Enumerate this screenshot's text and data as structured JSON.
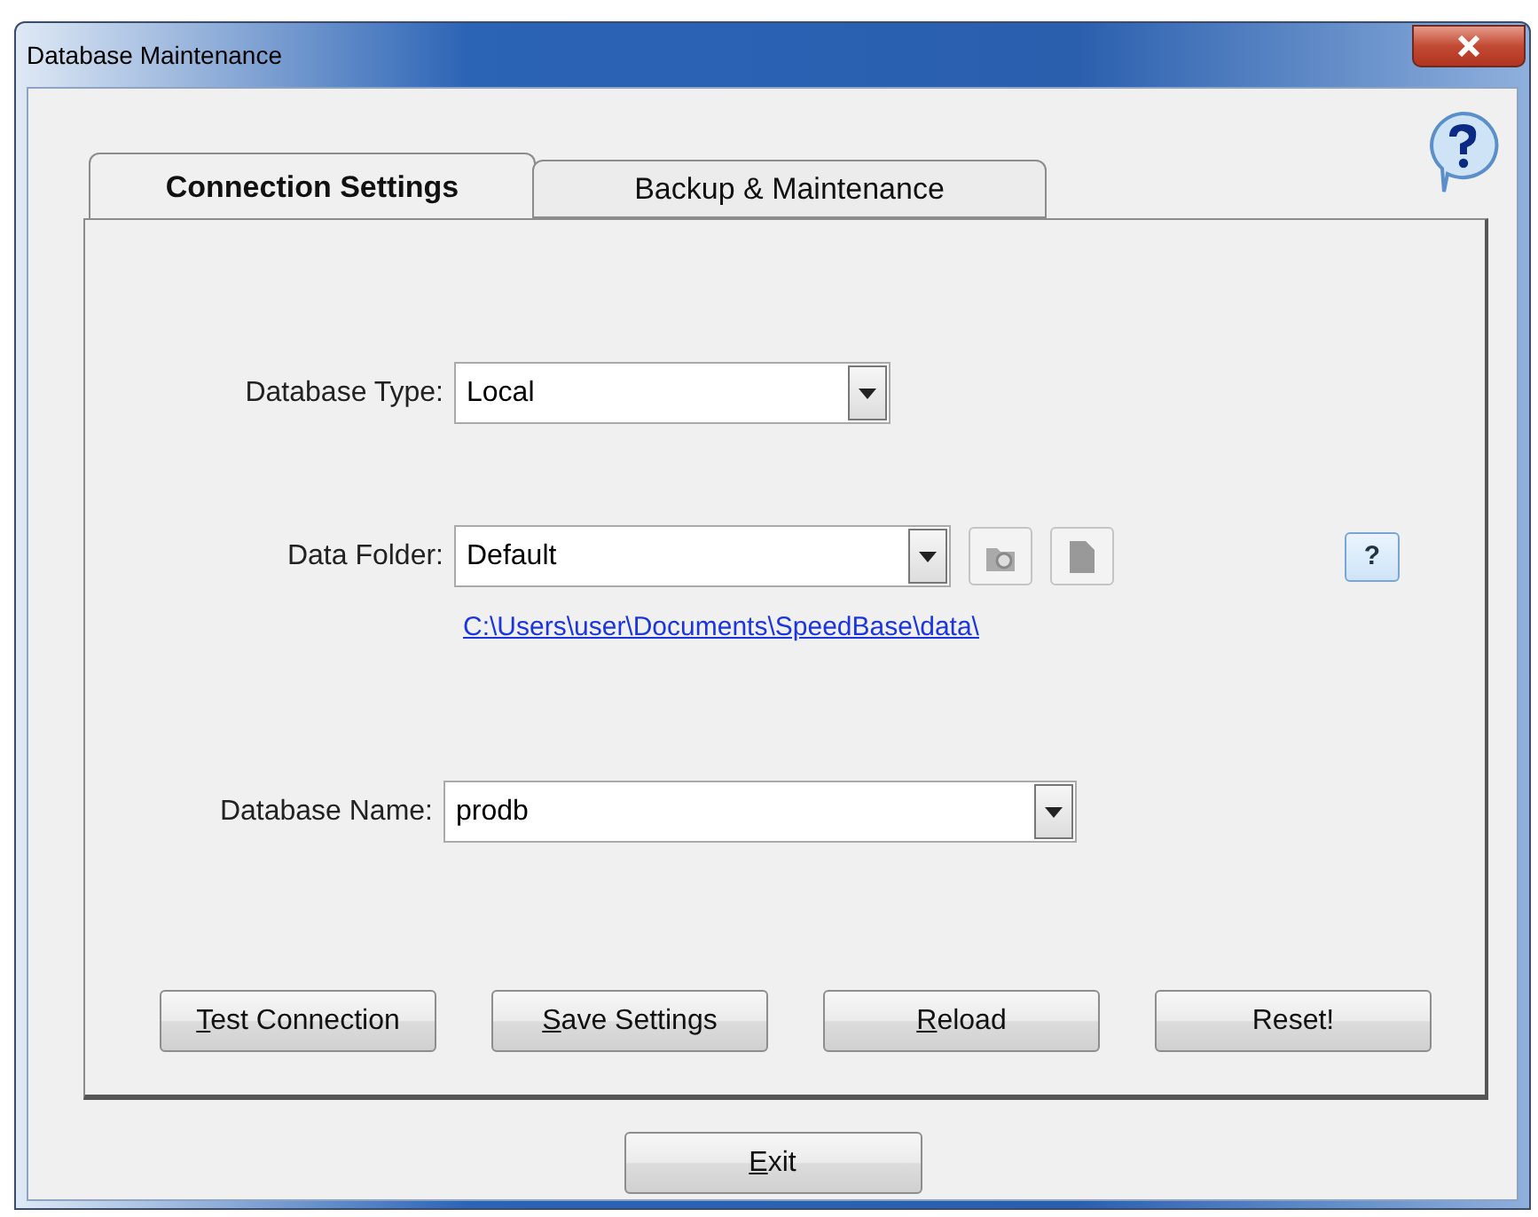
{
  "window": {
    "title": "Database Maintenance"
  },
  "tabs": [
    {
      "label": "Connection Settings",
      "selected": true
    },
    {
      "label": "Backup & Maintenance",
      "selected": false
    }
  ],
  "fields": [
    {
      "label": "Database Type:",
      "value": "Local"
    },
    {
      "label": "Data Folder:",
      "value": "Default",
      "path_link": "C:\\Users\\user\\Documents\\SpeedBase\\data\\",
      "help": "?"
    },
    {
      "label": "Database Name:",
      "value": "prodb"
    }
  ],
  "buttons": [
    {
      "access_key": "T",
      "label_rest": "est Connection"
    },
    {
      "access_key": "S",
      "label_rest": "ave Settings"
    },
    {
      "access_key": "R",
      "label_rest": "eload"
    },
    {
      "label_rest": "Reset!"
    }
  ],
  "exit_button": {
    "access_key": "E",
    "label_rest": "xit"
  }
}
